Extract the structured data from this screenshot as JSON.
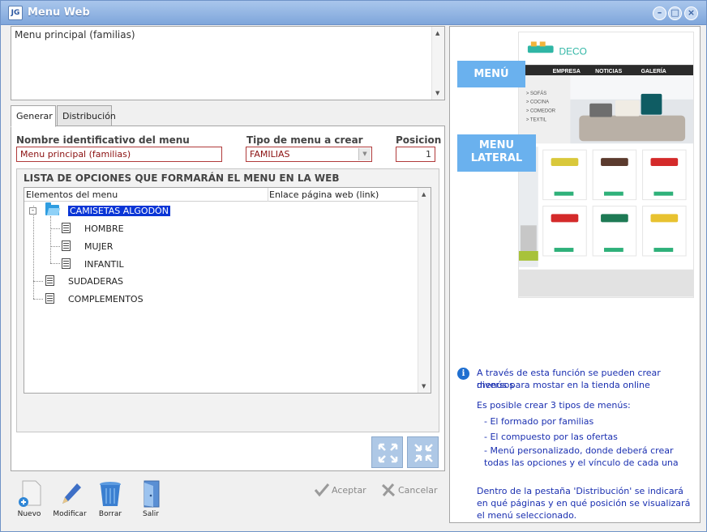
{
  "window": {
    "title": "Menu Web",
    "app_icon_text": "JG"
  },
  "description": {
    "value": "Menu principal (familias)"
  },
  "tabs": [
    {
      "label": "Generar",
      "active": true
    },
    {
      "label": "Distribución",
      "active": false
    }
  ],
  "form": {
    "name_label": "Nombre identificativo del menu",
    "name_value": "Menu principal (familias)",
    "type_label": "Tipo de menu a crear",
    "type_value": "FAMILIAS",
    "position_label": "Posicion",
    "position_value": "1"
  },
  "tree_panel": {
    "title": "LISTA DE OPCIONES QUE FORMARÁN EL MENU EN LA WEB",
    "col_elements": "Elementos del menu",
    "col_link": "Enlace página web (link)",
    "nodes": [
      {
        "label": "CAMISETAS ALGODÓN",
        "level": 0,
        "type": "folder",
        "selected": true
      },
      {
        "label": "HOMBRE",
        "level": 1,
        "type": "doc"
      },
      {
        "label": "MUJER",
        "level": 1,
        "type": "doc"
      },
      {
        "label": "INFANTIL",
        "level": 1,
        "type": "doc"
      },
      {
        "label": "SUDADERAS",
        "level": 0,
        "type": "doc"
      },
      {
        "label": "COMPLEMENTOS",
        "level": 0,
        "type": "doc"
      }
    ]
  },
  "actions": {
    "new": "Nuevo",
    "edit": "Modificar",
    "delete": "Borrar",
    "exit": "Salir",
    "accept": "Aceptar",
    "cancel": "Cancelar"
  },
  "preview": {
    "brand": "DECO",
    "nav": [
      "EMPRESA",
      "NOTICIAS",
      "GALERÍA"
    ],
    "side_menu": [
      "> SOFÁS",
      "> COCINA",
      "> COMEDOR",
      "> TEXTIL"
    ],
    "callout_menu": "MENÚ",
    "callout_lateral_1": "MENU",
    "callout_lateral_2": "LATERAL",
    "product_colors": [
      "#d9c83b",
      "#5b3b2e",
      "#d42a2a",
      "#d42a2a",
      "#1e7a55",
      "#e8c230"
    ]
  },
  "info": {
    "line1": "A través de esta función se pueden crear diversos",
    "line2": "menús para mostar en la tienda online",
    "line3": "Es posible crear 3 tipos de menús:",
    "line4": "- El formado por familias",
    "line5": "- El compuesto por las ofertas",
    "line6": "- Menú personalizado, donde deberá crear",
    "line7": "todas las opciones y el vínculo de cada una",
    "line8": "Dentro de la pestaña 'Distribución' se indicará",
    "line9": "en qué páginas y en qué posición se visualizará",
    "line10": "el menú seleccionado."
  },
  "colors": {
    "accent": "#6ab1ee",
    "selection": "#0a35d6",
    "info_text": "#1a2fb0",
    "field_border": "#b03a3a"
  }
}
